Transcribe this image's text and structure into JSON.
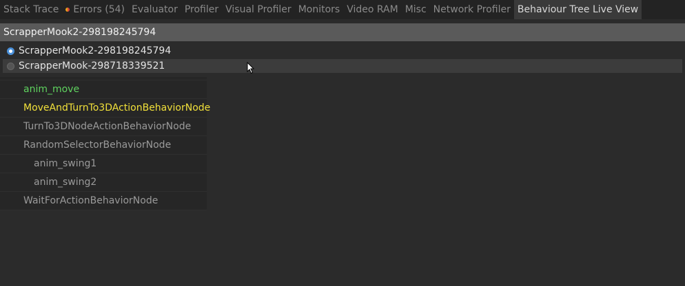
{
  "tabs": [
    {
      "label": "Stack Trace",
      "active": false
    },
    {
      "label": "Errors (54)",
      "active": false,
      "indicator": true
    },
    {
      "label": "Evaluator",
      "active": false
    },
    {
      "label": "Profiler",
      "active": false
    },
    {
      "label": "Visual Profiler",
      "active": false
    },
    {
      "label": "Monitors",
      "active": false
    },
    {
      "label": "Video RAM",
      "active": false
    },
    {
      "label": "Misc",
      "active": false
    },
    {
      "label": "Network Profiler",
      "active": false
    },
    {
      "label": "Behaviour Tree Live View",
      "active": true
    }
  ],
  "entity_picker": {
    "selected": "ScrapperMook2-298198245794"
  },
  "entity_options": [
    {
      "label": "ScrapperMook2-298198245794",
      "selected": true
    },
    {
      "label": "ScrapperMook-298718339521",
      "selected": false
    }
  ],
  "tree": [
    {
      "label": "anim_move",
      "status": "success"
    },
    {
      "label": "MoveAndTurnTo3DActionBehaviorNode",
      "status": "running"
    },
    {
      "label": "TurnTo3DNodeActionBehaviorNode",
      "status": "idle"
    },
    {
      "label": "RandomSelectorBehaviorNode",
      "status": "idle"
    },
    {
      "label": "anim_swing1",
      "status": "idle"
    },
    {
      "label": "anim_swing2",
      "status": "idle"
    },
    {
      "label": "WaitForActionBehaviorNode",
      "status": "idle"
    }
  ],
  "colors": {
    "success": "#5fd35f",
    "running": "#f1e03a",
    "idle": "#9a9a9a",
    "accent": "#4a90d9"
  }
}
